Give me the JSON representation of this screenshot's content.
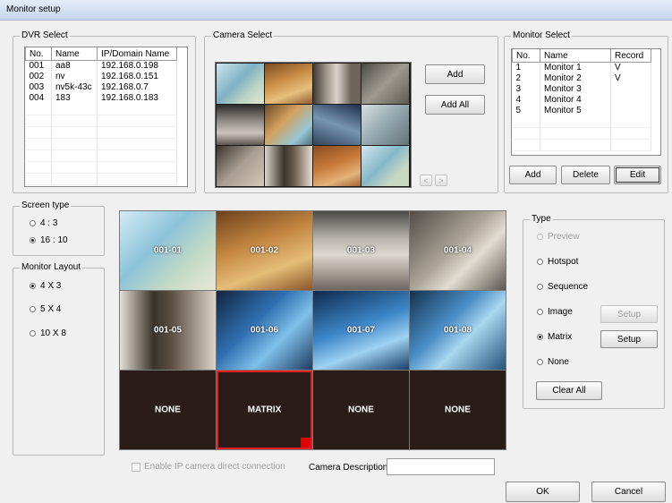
{
  "window": {
    "title": "Monitor setup"
  },
  "dvr_select": {
    "legend": "DVR Select",
    "columns": [
      "No.",
      "Name",
      "IP/Domain Name"
    ],
    "rows": [
      [
        "001",
        "aa8",
        "192.168.0.198"
      ],
      [
        "002",
        "nv",
        "192.168.0.151"
      ],
      [
        "003",
        "nv5k-43c",
        "192.168.0.7"
      ],
      [
        "004",
        "183",
        "192.168.0.183"
      ]
    ]
  },
  "camera_select": {
    "legend": "Camera Select",
    "add_label": "Add",
    "add_all_label": "Add All",
    "prev_label": "<",
    "next_label": ">"
  },
  "monitor_select": {
    "legend": "Monitor Select",
    "columns": [
      "No.",
      "Name",
      "Record"
    ],
    "rows": [
      [
        "1",
        "Monitor 1",
        "V"
      ],
      [
        "2",
        "Monitor 2",
        "V"
      ],
      [
        "3",
        "Monitor 3",
        ""
      ],
      [
        "4",
        "Monitor 4",
        ""
      ],
      [
        "5",
        "Monitor 5",
        ""
      ]
    ],
    "add_label": "Add",
    "delete_label": "Delete",
    "edit_label": "Edit"
  },
  "screen_type": {
    "legend": "Screen type",
    "options": [
      "4 : 3",
      "16 : 10"
    ],
    "selected": "16 : 10"
  },
  "monitor_layout": {
    "legend": "Monitor Layout",
    "options": [
      "4 X 3",
      "5 X 4",
      "10 X 8"
    ],
    "selected": "4 X 3"
  },
  "layout_grid": {
    "tiles": [
      "001-01",
      "001-02",
      "001-03",
      "001-04",
      "001-05",
      "001-06",
      "001-07",
      "001-08",
      "NONE",
      "MATRIX",
      "NONE",
      "NONE"
    ],
    "selected_tile": "MATRIX"
  },
  "type_group": {
    "legend": "Type",
    "options": [
      "Preview",
      "Hotspot",
      "Sequence",
      "Image",
      "Matrix",
      "None"
    ],
    "selected": "Matrix",
    "setup_label": "Setup",
    "clear_all_label": "Clear All"
  },
  "enable_ip_label": "Enable IP camera direct connection",
  "camera_description": {
    "label": "Camera Description",
    "value": ""
  },
  "ok_label": "OK",
  "cancel_label": "Cancel",
  "colors": {
    "selected_border": "#e02020",
    "empty_tile": "#2a1d19",
    "title_bar": "#c8d7ee"
  }
}
